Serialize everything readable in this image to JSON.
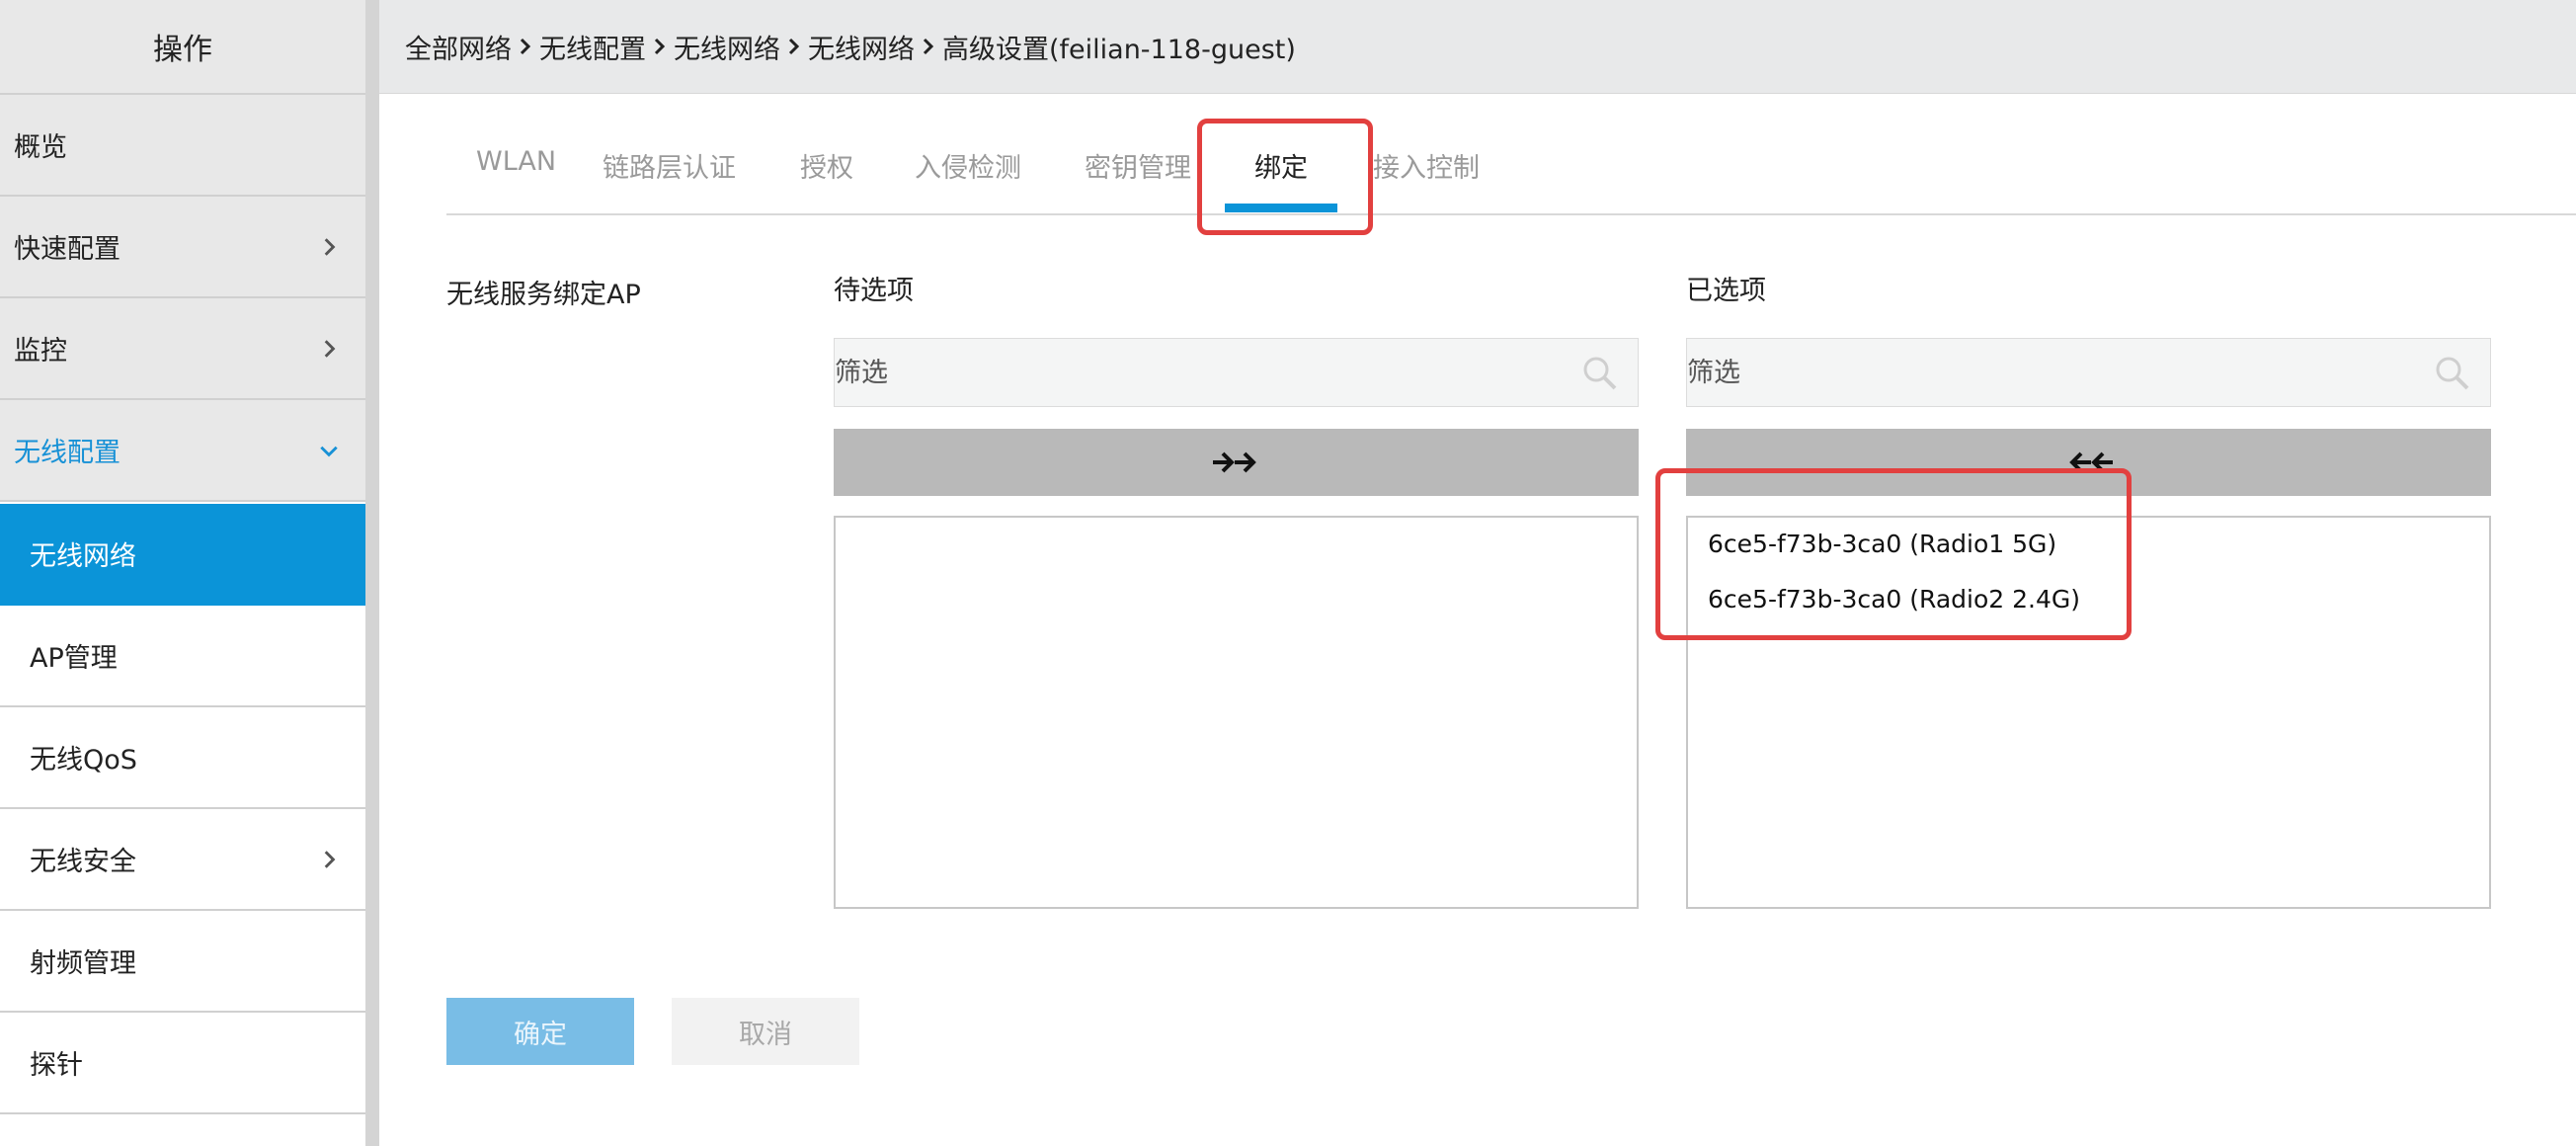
{
  "sidebar": {
    "header": "操作",
    "items": [
      {
        "label": "概览"
      },
      {
        "label": "快速配置"
      },
      {
        "label": "监控"
      },
      {
        "label": "无线配置"
      },
      {
        "label": "无线网络"
      },
      {
        "label": "AP管理"
      },
      {
        "label": "无线QoS"
      },
      {
        "label": "无线安全"
      },
      {
        "label": "射频管理"
      },
      {
        "label": "探针"
      }
    ]
  },
  "breadcrumb": {
    "items": [
      "全部网络",
      "无线配置",
      "无线网络",
      "无线网络",
      "高级设置(feilian-118-guest)"
    ]
  },
  "tabs": [
    {
      "label": "WLAN"
    },
    {
      "label": "链路层认证"
    },
    {
      "label": "授权"
    },
    {
      "label": "入侵检测"
    },
    {
      "label": "密钥管理"
    },
    {
      "label": "绑定"
    },
    {
      "label": "接入控制"
    }
  ],
  "active_tab": "绑定",
  "form": {
    "field_label": "无线服务绑定AP",
    "available": {
      "title": "待选项",
      "filter_placeholder": "筛选",
      "items": []
    },
    "selected": {
      "title": "已选项",
      "filter_placeholder": "筛选",
      "items": [
        "6ce5-f73b-3ca0 (Radio1 5G)",
        "6ce5-f73b-3ca0 (Radio2 2.4G)"
      ]
    }
  },
  "buttons": {
    "confirm": "确定",
    "cancel": "取消"
  },
  "colors": {
    "accent": "#0b94d8",
    "highlight": "#e2403f",
    "confirm_bg": "#79bde6",
    "cancel_bg": "#f2f2f2"
  }
}
